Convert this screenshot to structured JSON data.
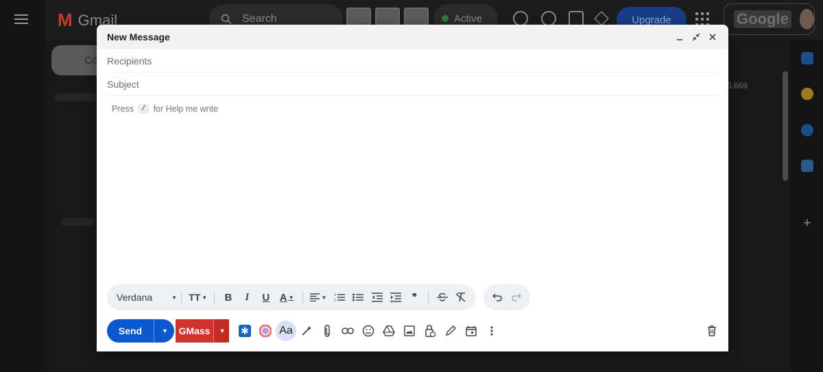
{
  "background": {
    "app_name": "Gmail",
    "search_placeholder": "Search",
    "status_label": "Active",
    "upgrade_label": "Upgrade",
    "account_logo_text": "Google",
    "compose_label": "Co",
    "mail_count": "6,669"
  },
  "compose": {
    "title": "New Message",
    "recipients_placeholder": "Recipients",
    "subject_placeholder": "Subject",
    "body_hint_prefix": "Press",
    "body_hint_key": "/",
    "body_hint_suffix": "for Help me write"
  },
  "formatting": {
    "font_name": "Verdana"
  },
  "actions": {
    "send_label": "Send",
    "gmass_label": "GMass",
    "text_format_label": "Aa"
  },
  "colors": {
    "send_blue": "#0b57d0",
    "gmass_red": "#d0332c"
  }
}
